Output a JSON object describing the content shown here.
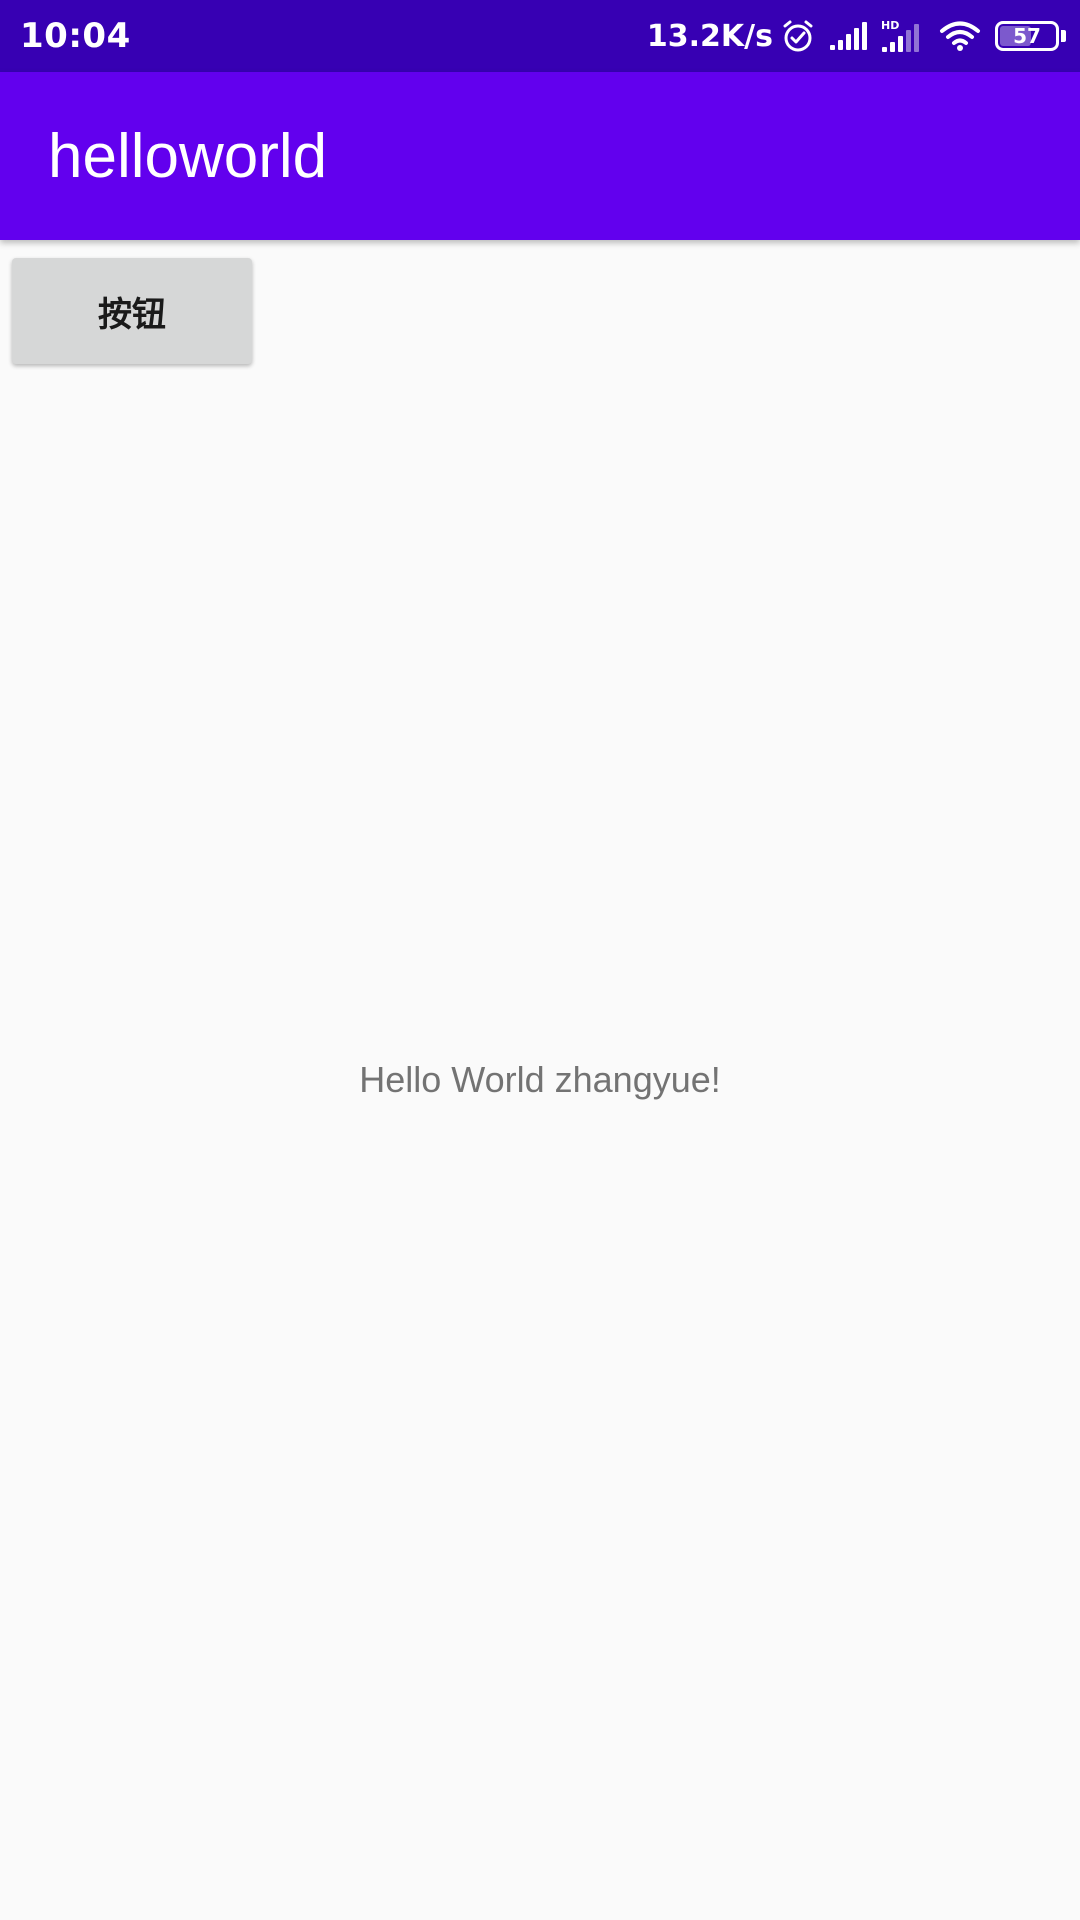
{
  "status_bar": {
    "time": "10:04",
    "net_speed": "13.2K/s",
    "hd_label": "HD",
    "battery_level": "57",
    "battery_fraction": 0.57,
    "icons": [
      "alarm-icon",
      "signal-icon",
      "hd-signal-icon",
      "wifi-icon",
      "battery-icon"
    ]
  },
  "app_bar": {
    "title": "helloworld"
  },
  "main": {
    "button_label": "按钮",
    "hello_text": "Hello World zhangyue!"
  },
  "colors": {
    "status_bar": "#3700b3",
    "app_bar": "#6200ee",
    "background": "#fafafa",
    "button": "#d6d7d7",
    "hello_text": "#737373"
  }
}
